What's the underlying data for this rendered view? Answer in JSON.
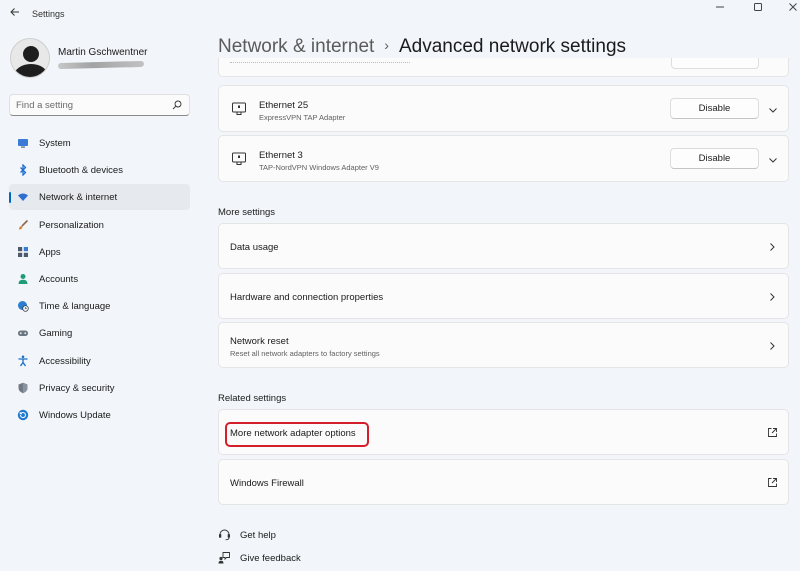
{
  "window": {
    "app_title": "Settings",
    "back_icon": "back-arrow-icon",
    "minimize_glyph": "—",
    "maximize_glyph": "☐",
    "close_glyph": "✕"
  },
  "user": {
    "name": "Martin Gschwentner"
  },
  "search": {
    "placeholder": "Find a setting"
  },
  "sidebar": {
    "items": [
      {
        "label": "System",
        "icon": "monitor-icon",
        "color": "#3a7bd5",
        "active": false
      },
      {
        "label": "Bluetooth & devices",
        "icon": "bluetooth-icon",
        "color": "#1f6fd1",
        "active": false
      },
      {
        "label": "Network & internet",
        "icon": "wifi-icon",
        "color": "#2f6fcf",
        "active": true
      },
      {
        "label": "Personalization",
        "icon": "brush-icon",
        "color": "#d4832a",
        "active": false
      },
      {
        "label": "Apps",
        "icon": "apps-icon",
        "color": "#4d5a6b",
        "active": false
      },
      {
        "label": "Accounts",
        "icon": "person-icon",
        "color": "#1f9c7a",
        "active": false
      },
      {
        "label": "Time & language",
        "icon": "globe-clock-icon",
        "color": "#2a7fd0",
        "active": false
      },
      {
        "label": "Gaming",
        "icon": "gamepad-icon",
        "color": "#6b7682",
        "active": false
      },
      {
        "label": "Accessibility",
        "icon": "accessibility-icon",
        "color": "#1a6fc8",
        "active": false
      },
      {
        "label": "Privacy & security",
        "icon": "shield-icon",
        "color": "#707a85",
        "active": false
      },
      {
        "label": "Windows Update",
        "icon": "update-icon",
        "color": "#1f7ad1",
        "active": false
      }
    ],
    "accent": "#0067c0"
  },
  "breadcrumb": {
    "parent": "Network & internet",
    "separator": "›",
    "current": "Advanced network settings"
  },
  "adapters": [
    {
      "name": "Ethernet 25",
      "description": "ExpressVPN TAP Adapter",
      "button": "Disable"
    },
    {
      "name": "Ethernet 3",
      "description": "TAP-NordVPN Windows Adapter V9",
      "button": "Disable"
    }
  ],
  "more_settings": {
    "title": "More settings",
    "items": [
      {
        "label": "Data usage",
        "sub": ""
      },
      {
        "label": "Hardware and connection properties",
        "sub": ""
      },
      {
        "label": "Network reset",
        "sub": "Reset all network adapters to factory settings"
      }
    ]
  },
  "related_settings": {
    "title": "Related settings",
    "items": [
      {
        "label": "More network adapter options",
        "highlighted": true
      },
      {
        "label": "Windows Firewall",
        "highlighted": false
      }
    ],
    "highlight_color": "#d41e2c"
  },
  "footer": {
    "help": "Get help",
    "feedback": "Give feedback"
  }
}
